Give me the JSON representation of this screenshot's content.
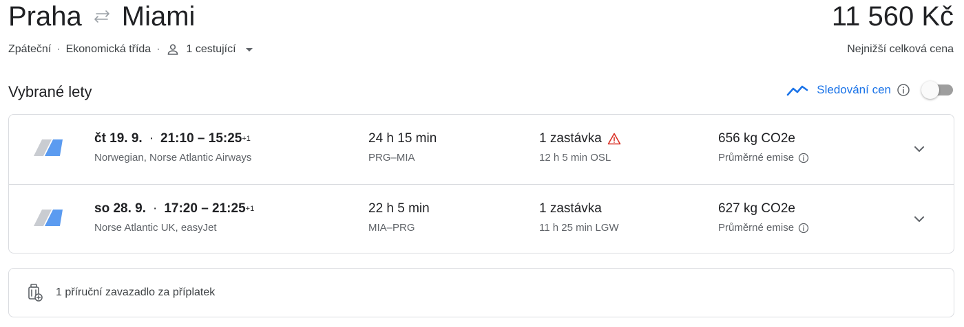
{
  "header": {
    "origin": "Praha",
    "destination": "Miami",
    "swap_icon": "swap-arrows-icon",
    "price": "11 560 Kč",
    "price_caption": "Nejnižší celková cena",
    "trip_type": "Zpáteční",
    "cabin_class": "Ekonomická třída",
    "passengers": "1 cestující",
    "separator": "·"
  },
  "section": {
    "title": "Vybrané lety",
    "price_tracking_label": "Sledování cen",
    "price_tracking_on": false
  },
  "flights": [
    {
      "date": "čt 19. 9.",
      "times": "21:10 – 15:25",
      "day_offset": "+1",
      "airlines": "Norwegian, Norse Atlantic Airways",
      "duration": "24 h 15 min",
      "route": "PRG–MIA",
      "stops": "1 zastávka",
      "stop_warning": true,
      "layover": "12 h 5 min OSL",
      "emissions": "656 kg CO2e",
      "emissions_label": "Průměrné emise"
    },
    {
      "date": "so 28. 9.",
      "times": "17:20 – 21:25",
      "day_offset": "+1",
      "airlines": "Norse Atlantic UK, easyJet",
      "duration": "22 h 5 min",
      "route": "MIA–PRG",
      "stops": "1 zastávka",
      "stop_warning": false,
      "layover": "11 h 25 min LGW",
      "emissions": "627 kg CO2e",
      "emissions_label": "Průměrné emise"
    }
  ],
  "baggage": {
    "text": "1 příruční zavazadlo za příplatek"
  },
  "colors": {
    "accent_blue": "#1a73e8",
    "warning_red": "#d93025",
    "text_primary": "#202124",
    "text_secondary": "#5f6368",
    "border": "#dadce0"
  }
}
